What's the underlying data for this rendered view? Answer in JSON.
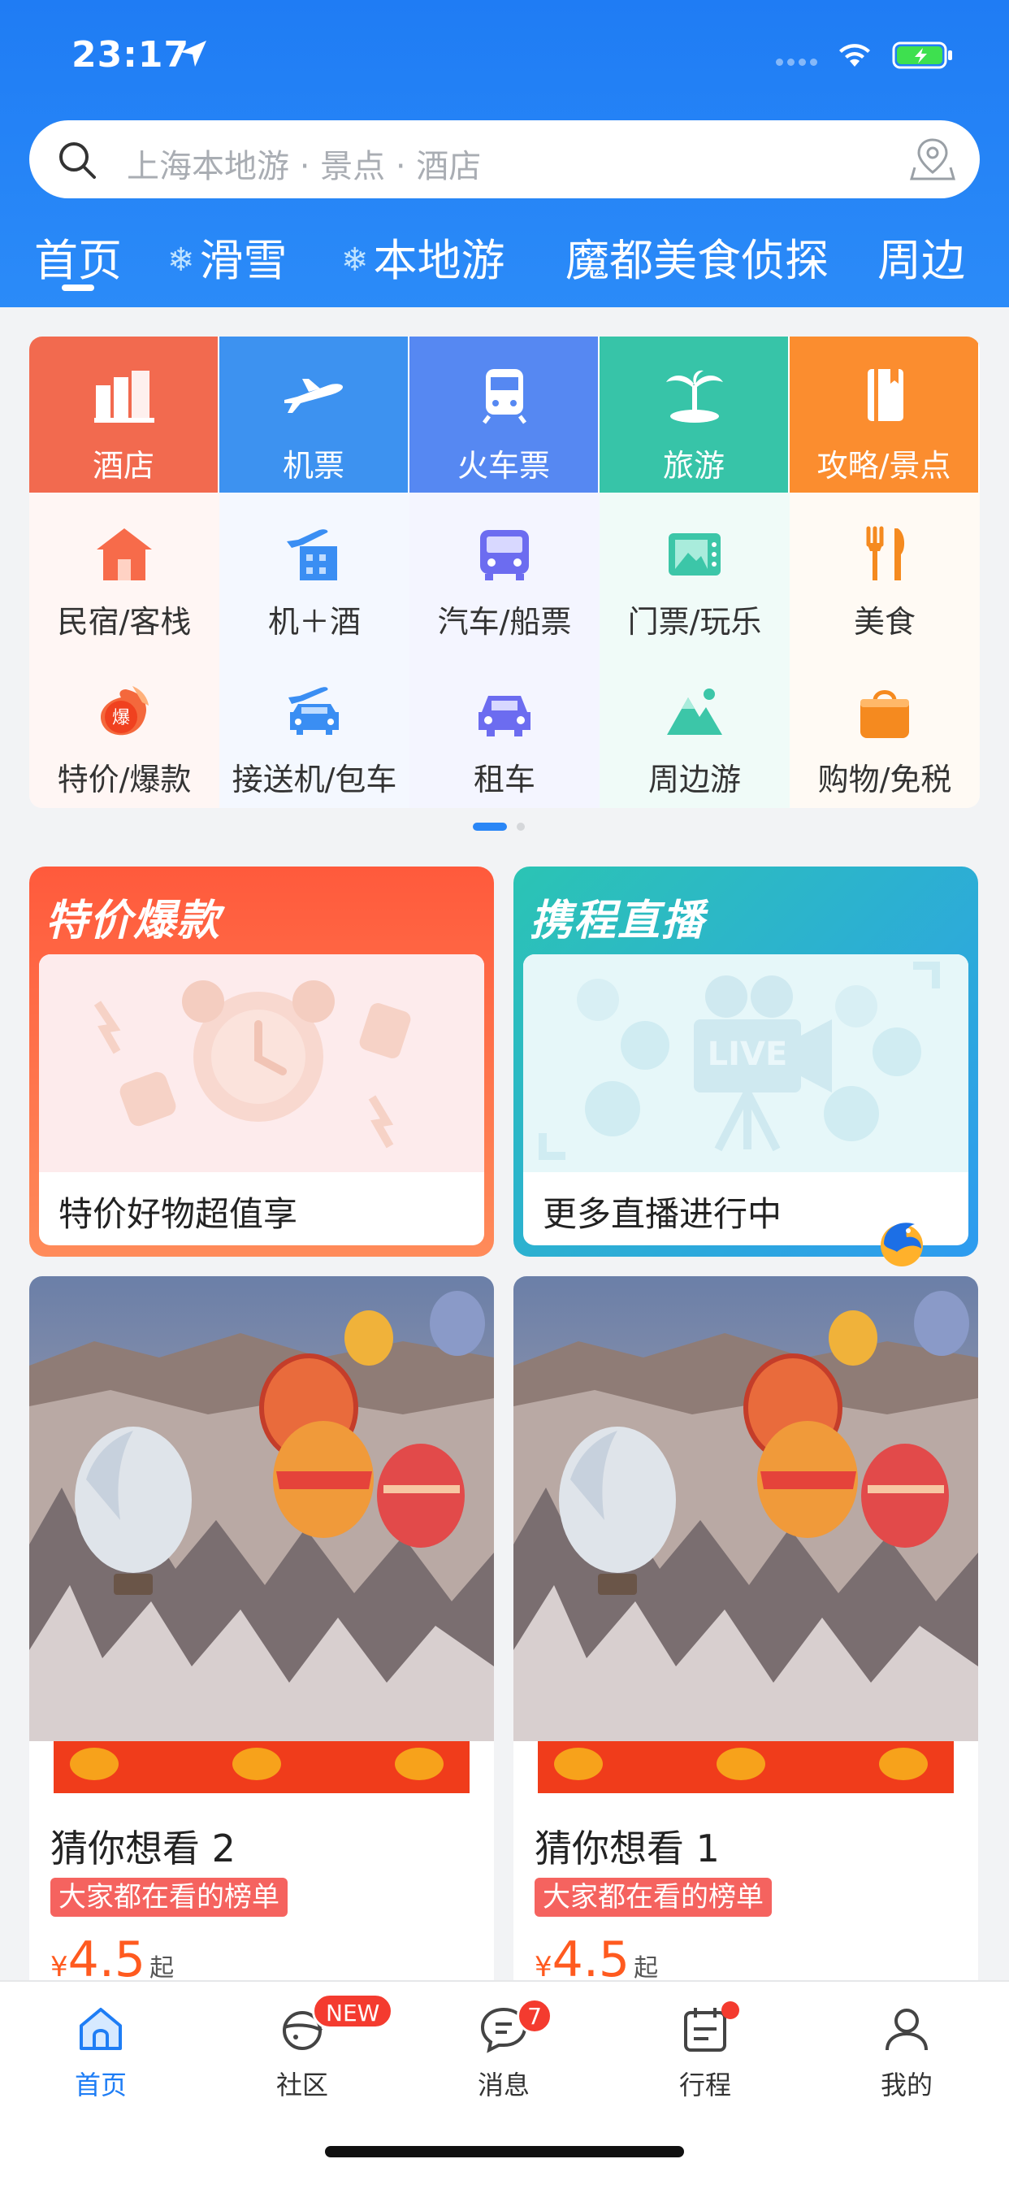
{
  "status_bar": {
    "time": "23:17"
  },
  "search": {
    "placeholder": "上海本地游 · 景点 · 酒店"
  },
  "top_tabs": [
    {
      "label": "首页",
      "icon": null
    },
    {
      "label": "滑雪",
      "icon": "snowflake-icon"
    },
    {
      "label": "本地游",
      "icon": "snowflake-icon"
    },
    {
      "label": "魔都美食侦探",
      "icon": null
    },
    {
      "label": "周边",
      "icon": null
    }
  ],
  "main_categories": [
    {
      "label": "酒店",
      "icon": "hotel-icon",
      "color": "#f26a4f"
    },
    {
      "label": "机票",
      "icon": "airplane-icon",
      "color": "#3d92f0"
    },
    {
      "label": "火车票",
      "icon": "train-icon",
      "color": "#5688f2"
    },
    {
      "label": "旅游",
      "icon": "palm-tree-icon",
      "color": "#37c4a8"
    },
    {
      "label": "攻略/景点",
      "icon": "guide-book-icon",
      "color": "#fb8d2f"
    }
  ],
  "sub_categories": [
    {
      "label": "民宿/客栈",
      "icon": "homestay-icon"
    },
    {
      "label": "机＋酒",
      "icon": "flight-hotel-icon"
    },
    {
      "label": "汽车/船票",
      "icon": "bus-icon"
    },
    {
      "label": "门票/玩乐",
      "icon": "ticket-icon"
    },
    {
      "label": "美食",
      "icon": "fork-knife-icon"
    },
    {
      "label": "特价/爆款",
      "icon": "hot-deal-icon"
    },
    {
      "label": "接送机/包车",
      "icon": "airport-transfer-icon"
    },
    {
      "label": "租车",
      "icon": "car-rental-icon"
    },
    {
      "label": "周边游",
      "icon": "mountain-icon"
    },
    {
      "label": "购物/免税",
      "icon": "shopping-bag-icon"
    }
  ],
  "carousel": {
    "page": 1,
    "pages": 2
  },
  "promos": [
    {
      "title": "特价爆款",
      "caption": "特价好物超值享"
    },
    {
      "title": "携程直播",
      "caption": "更多直播进行中"
    }
  ],
  "feed": [
    {
      "title": "猜你想看 2",
      "tag": "大家都在看的榜单",
      "currency": "¥",
      "price": "4.5",
      "suffix": "起"
    },
    {
      "title": "猜你想看 1",
      "tag": "大家都在看的榜单",
      "currency": "¥",
      "price": "4.5",
      "suffix": "起"
    }
  ],
  "bottom_tabs": [
    {
      "label": "首页",
      "icon": "home-icon",
      "active": true
    },
    {
      "label": "社区",
      "icon": "community-icon",
      "badge": "NEW"
    },
    {
      "label": "消息",
      "icon": "message-icon",
      "badge": "7"
    },
    {
      "label": "行程",
      "icon": "calendar-icon",
      "badge": "dot"
    },
    {
      "label": "我的",
      "icon": "profile-icon"
    }
  ]
}
